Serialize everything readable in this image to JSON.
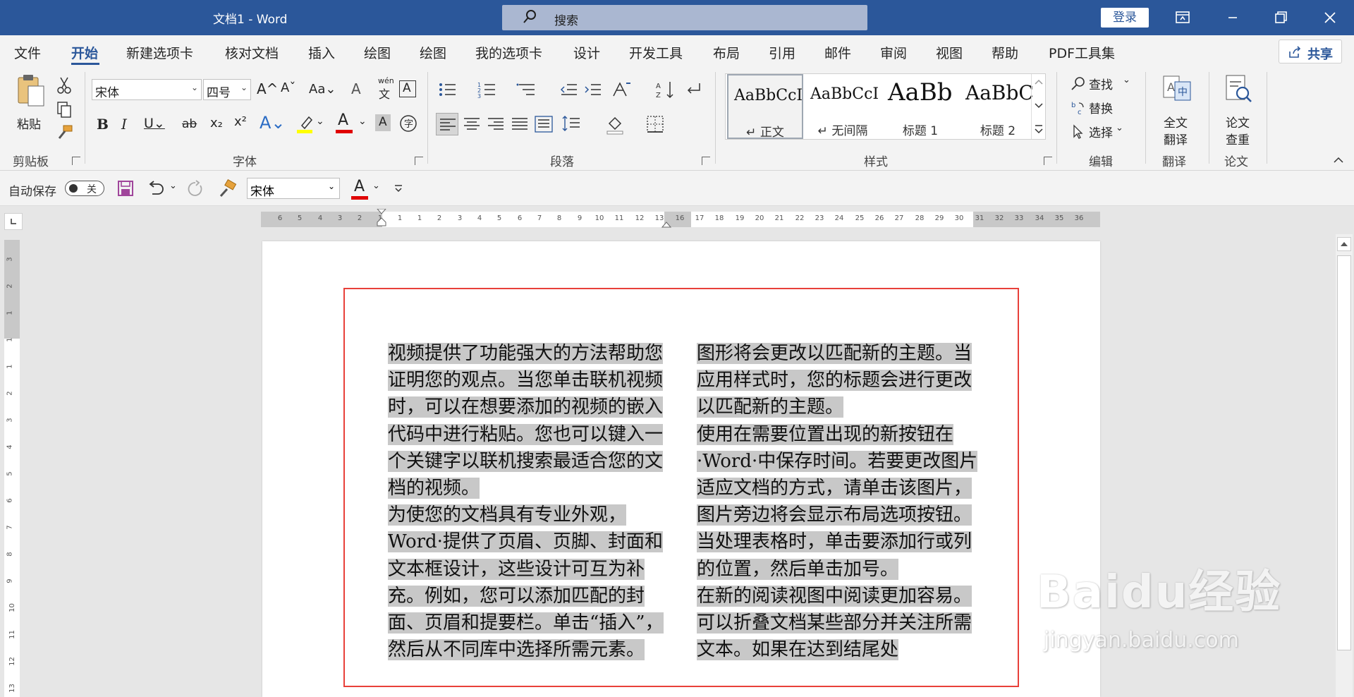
{
  "window": {
    "title": "文档1 - Word",
    "search_placeholder": "搜索",
    "login_label": "登录"
  },
  "tabs": [
    {
      "label": "文件",
      "active": false
    },
    {
      "label": "开始",
      "active": true
    },
    {
      "label": "新建选项卡",
      "active": false
    },
    {
      "label": "核对文档",
      "active": false
    },
    {
      "label": "插入",
      "active": false
    },
    {
      "label": "绘图",
      "active": false
    },
    {
      "label": "绘图",
      "active": false
    },
    {
      "label": "我的选项卡",
      "active": false
    },
    {
      "label": "设计",
      "active": false
    },
    {
      "label": "开发工具",
      "active": false
    },
    {
      "label": "布局",
      "active": false
    },
    {
      "label": "引用",
      "active": false
    },
    {
      "label": "邮件",
      "active": false
    },
    {
      "label": "审阅",
      "active": false
    },
    {
      "label": "视图",
      "active": false
    },
    {
      "label": "帮助",
      "active": false
    },
    {
      "label": "PDF工具集",
      "active": false
    }
  ],
  "share_label": "共享",
  "ribbon": {
    "clipboard": {
      "paste_label": "粘贴",
      "group_label": "剪贴板"
    },
    "font": {
      "font_name": "宋体",
      "font_size": "四号",
      "group_label": "字体",
      "wen_label": "wén",
      "wen_char": "文",
      "char_a": "A"
    },
    "paragraph": {
      "group_label": "段落"
    },
    "styles": {
      "group_label": "样式",
      "items": [
        {
          "sample": "AaBbCcI",
          "name": "↵ 正文"
        },
        {
          "sample": "AaBbCcI",
          "name": "↵ 无间隔"
        },
        {
          "sample": "AaBb",
          "name": "标题 1"
        },
        {
          "sample": "AaBbC",
          "name": "标题 2"
        }
      ]
    },
    "editing": {
      "find_label": "查找",
      "replace_label": "替换",
      "select_label": "选择",
      "group_label": "编辑"
    },
    "translate": {
      "full_label_1": "全文",
      "full_label_2": "翻译",
      "group_label": "翻译"
    },
    "paper": {
      "check_label_1": "论文",
      "check_label_2": "查重",
      "group_label": "论文"
    }
  },
  "qat": {
    "autosave_label": "自动保存",
    "toggle_state": "关",
    "font_name": "宋体"
  },
  "ruler": {
    "h_numbers": [
      "6",
      "5",
      "4",
      "3",
      "2",
      "1",
      "1",
      "1",
      "2",
      "3",
      "4",
      "5",
      "6",
      "7",
      "8",
      "9",
      "10",
      "11",
      "12",
      "13",
      "16",
      "17",
      "18",
      "19",
      "20",
      "21",
      "22",
      "23",
      "24",
      "25",
      "26",
      "27",
      "28",
      "29",
      "30",
      "31",
      "32",
      "33",
      "34",
      "35",
      "36"
    ],
    "v_numbers": [
      "3",
      "2",
      "1",
      "1",
      "1",
      "2",
      "3",
      "4",
      "5",
      "6",
      "7",
      "8",
      "9",
      "10",
      "11",
      "12",
      "13"
    ]
  },
  "document": {
    "column1": [
      "视频提供了功能强大的方法帮助您证明您的观点。当您单击联机视频时，可以在想要添加的视频的嵌入代码中进行粘贴。您也可以键入一个关键字以联机搜索最适合您的文档的视频。",
      "为使您的文档具有专业外观，Word·提供了页眉、页脚、封面和文本框设计，这些设计可互为补充。例如，您可以添加匹配的封面、页眉和提要栏。单击“插入”，然后从不同库中选择所需元素。"
    ],
    "column2": [
      "图形将会更改以匹配新的主题。当应用样式时，您的标题会进行更改以匹配新的主题。",
      "使用在需要位置出现的新按钮在·Word·中保存时间。若要更改图片适应文档的方式，请单击该图片，图片旁边将会显示布局选项按钮。当处理表格时，单击要添加行或列的位置，然后单击加号。",
      "在新的阅读视图中阅读更加容易。可以折叠文档某些部分并关注所需文本。如果在达到结尾处"
    ]
  },
  "watermark": {
    "brand": "Baidu经验",
    "url": "jingyan.baidu.com"
  },
  "colors": {
    "titlebar": "#2b579a",
    "highlight": "#c8c8c8",
    "redbox": "#e8403a"
  }
}
